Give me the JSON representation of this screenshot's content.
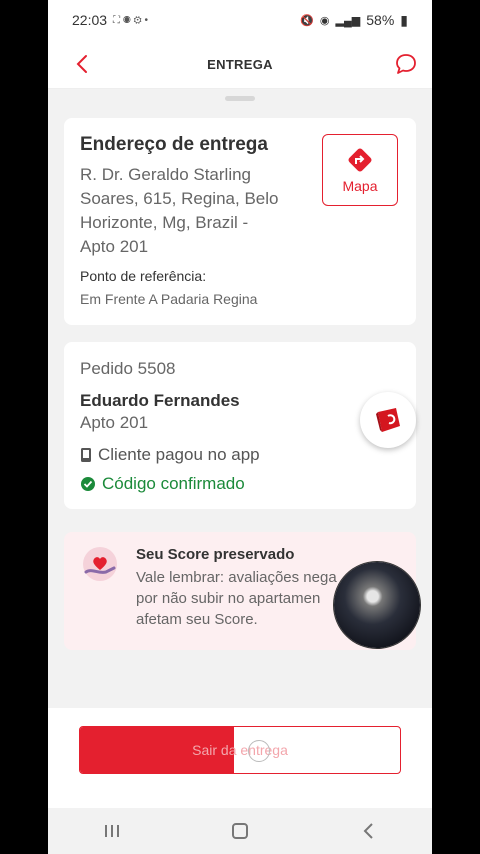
{
  "status_bar": {
    "time": "22:03",
    "battery": "58%"
  },
  "header": {
    "title": "ENTREGA"
  },
  "address": {
    "title": "Endereço de entrega",
    "lines": [
      "R. Dr. Geraldo Starling",
      "Soares, 615, Regina, Belo",
      "Horizonte, Mg, Brazil -",
      "Apto 201"
    ],
    "reference_label": "Ponto de referência:",
    "reference_value": "Em Frente A Padaria Regina",
    "map_label": "Mapa"
  },
  "order": {
    "number": "Pedido 5508",
    "customer_name": "Eduardo Fernandes",
    "customer_apt": "Apto 201",
    "payment_status": "Cliente pagou no app",
    "code_status": "Código confirmado"
  },
  "score": {
    "title": "Seu Score preservado",
    "text": "Vale lembrar: avaliações nega por não subir no apartamen afetam seu Score."
  },
  "action": {
    "label": "Sair da entrega",
    "progress": 0.48
  },
  "colors": {
    "brand": "#e4202f",
    "success": "#1b8a3a"
  },
  "icons": {
    "back": "chevron-left-icon",
    "chat": "chat-bubble-icon",
    "map": "map-arrow-icon",
    "bag": "delivery-bag-icon",
    "phone": "phone-icon",
    "check": "check-circle-icon",
    "score": "heart-hand-icon"
  }
}
